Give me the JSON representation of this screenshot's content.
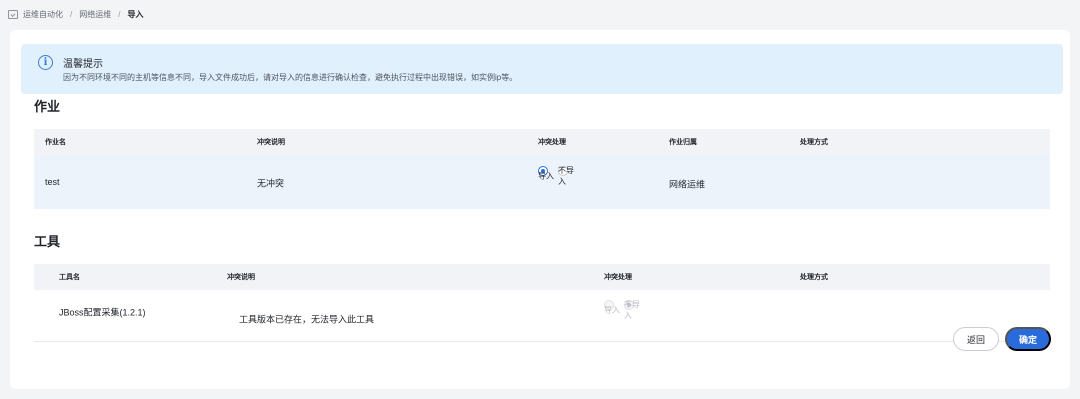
{
  "breadcrumb": {
    "items": [
      "运维自动化",
      "网络运维"
    ],
    "current": "导入"
  },
  "notice": {
    "title": "温馨提示",
    "text": "因为不同环境不同的主机等信息不同，导入文件成功后，请对导入的信息进行确认检查，避免执行过程中出现错误，如实例ip等。"
  },
  "jobs": {
    "title": "作业",
    "columns": [
      "作业名",
      "冲突说明",
      "冲突处理",
      "作业归属",
      "处理方式"
    ],
    "rows": [
      {
        "name": "test",
        "conflict": "无冲突",
        "options": [
          "导入",
          "不导入"
        ],
        "selected": "导入",
        "owner": "网络运维",
        "method": ""
      }
    ]
  },
  "tools": {
    "title": "工具",
    "columns": [
      "工具名",
      "冲突说明",
      "冲突处理",
      "处理方式"
    ],
    "rows": [
      {
        "name": "JBoss配置采集(1.2.1)",
        "conflict": "工具版本已存在，无法导入此工具",
        "options": [
          "导入",
          "不导入"
        ],
        "selected": "不导入",
        "disabled": true,
        "method": ""
      }
    ]
  },
  "buttons": {
    "back": "返回",
    "confirm": "确定"
  },
  "colors": {
    "primary": "#2a6bdb",
    "notice_bg": "#e1f0fd",
    "row_highlight": "#edf3fb"
  }
}
